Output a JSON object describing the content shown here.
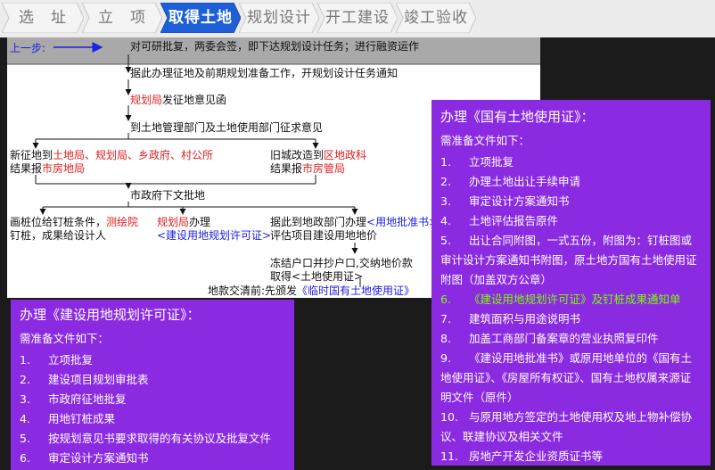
{
  "tabs": [
    {
      "label": "选　址",
      "active": false
    },
    {
      "label": "立　项",
      "active": false
    },
    {
      "label": "取得土地",
      "active": true
    },
    {
      "label": "规划设计",
      "active": false
    },
    {
      "label": "开工建设",
      "active": false
    },
    {
      "label": "竣工验收",
      "active": false
    }
  ],
  "flow": {
    "prev_label": "上一步:",
    "header": "对可研批复，两委会签，即下达规划设计任务；进行融资运作",
    "step1": "据此办理征地及前期规划准备工作，开规划设计任务通知",
    "step2_red": "规划局",
    "step2_rest": "发征地意见函",
    "step3": "到土地管理部门及土地使用部门征求意见",
    "left_a1": "新征地到",
    "left_a2": "土地局、规划局、乡政府、村公所",
    "left_b1": "结果报",
    "left_b2": "市房地局",
    "right_a1": "旧城改造到",
    "right_a2": "区地政科",
    "right_b1": "结果报",
    "right_b2": "市房管局",
    "step4": "市政府下文批地",
    "c1_a1": "画桩位给钉桩条件，",
    "c1_a2": "测绘院",
    "c1_b": "钉桩，成果给设计人",
    "c2_a1": "规划局",
    "c2_a2": "办理",
    "c2_b": "<建设用地规划许可证>",
    "c3_a1": "据此到地政部门办理",
    "c3_a2": "<用地批准书>",
    "c3_b": "评估项目建设用地地价",
    "c3_c": "冻结户口并抄户口,交纳地价款",
    "c3_d": "取得<土地使用证>",
    "bottom_a": "地款交清前:先颁发",
    "bottom_b": "《临时国有土地使用证》",
    "colors": {
      "red": "#e02020",
      "blue": "#2020e0",
      "panel": "#8a2be2",
      "active_tab": "#1e5fd8"
    }
  },
  "panel_right": {
    "title": "办理《国有土地使用证》：",
    "subtitle": "需准备文件如下：",
    "items": [
      {
        "num": "1.",
        "text": "立项批复"
      },
      {
        "num": "2.",
        "text": "办理土地出让手续申请"
      },
      {
        "num": "3.",
        "text": "审定设计方案通知书"
      },
      {
        "num": "4.",
        "text": "土地评估报告原件"
      },
      {
        "num": "5.",
        "text": "出让合同附图，一式五份，附图为：钉桩图或审计设计方案通知书附图，原土地方国有土地使用证附图（加盖双方公章）"
      },
      {
        "num": "6.",
        "text": "《建设用地规划许可证》及钉桩成果通知单",
        "highlight": true
      },
      {
        "num": "7.",
        "text": "建筑面积与用途说明书"
      },
      {
        "num": "8.",
        "text": "加盖工商部门备案章的营业执照复印件"
      },
      {
        "num": "9.",
        "text": "《建设用地批准书》或原用地单位的《国有土地使用证》、《房屋所有权证》、国有土地权属来源证明文件（原件）"
      },
      {
        "num": "10.",
        "text": "与原用地方签定的土地使用权及地上物补偿协议、联建协议及相关文件"
      },
      {
        "num": "11.",
        "text": "房地产开发企业资质证书等"
      }
    ]
  },
  "panel_left": {
    "title": "办理《建设用地规划许可证》：",
    "subtitle": "需准备文件如下：",
    "items": [
      {
        "num": "1.",
        "text": "立项批复"
      },
      {
        "num": "2.",
        "text": "建设项目规划审批表"
      },
      {
        "num": "3.",
        "text": "市政府征地批复"
      },
      {
        "num": "4.",
        "text": "用地钉桩成果"
      },
      {
        "num": "5.",
        "text": "按规划意见书要求取得的有关协议及批复文件"
      },
      {
        "num": "6.",
        "text": "审定设计方案通知书"
      }
    ]
  }
}
